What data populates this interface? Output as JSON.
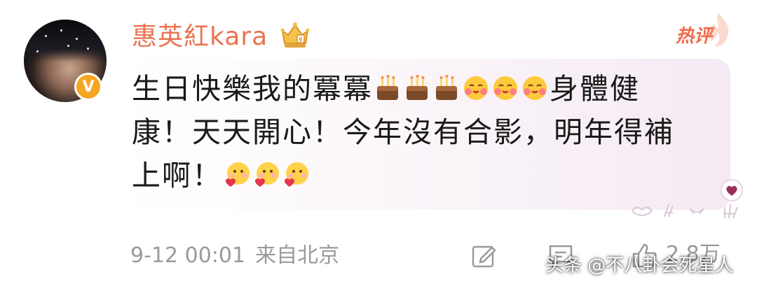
{
  "comment": {
    "username": "惠英紅kara",
    "hot_label": "热评",
    "text_line1_a": "生日快樂我的冪冪",
    "text_line1_b": "身體健",
    "text_line2": "康！天天開心！今年沒有合影，明年得補",
    "text_line3": "上啊！",
    "emoji_cake": "cake",
    "emoji_hug": "hug",
    "emoji_love": "love"
  },
  "meta": {
    "timestamp": "9-12 00:01",
    "source": "来自北京",
    "like_count": "2.8万"
  },
  "watermark": "头条 @不八卦会死星人",
  "colors": {
    "username": "#eb7350",
    "hot": "#f06a4a",
    "meta": "#9a9a9a",
    "verified_badge": "#f5a623"
  },
  "icons": {
    "verified": "v-badge-icon",
    "membership": "crown-icon",
    "edit": "edit-icon",
    "comment": "comment-icon",
    "like": "thumbs-up-icon"
  },
  "verified_letter": "V"
}
